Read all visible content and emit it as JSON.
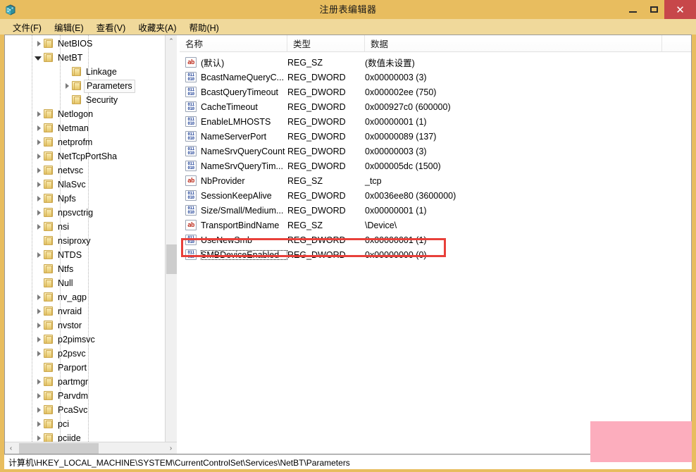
{
  "window": {
    "title": "注册表编辑器",
    "icon": "regedit-icon",
    "minimize_label": "–",
    "maximize_label": "□",
    "close_label": "✕"
  },
  "menubar": {
    "items": [
      {
        "label": "文件(F)",
        "name": "menu-file"
      },
      {
        "label": "编辑(E)",
        "name": "menu-edit"
      },
      {
        "label": "查看(V)",
        "name": "menu-view"
      },
      {
        "label": "收藏夹(A)",
        "name": "menu-favorites"
      },
      {
        "label": "帮助(H)",
        "name": "menu-help"
      }
    ]
  },
  "tree": {
    "nodes": [
      {
        "label": "NetBIOS",
        "indent": 2,
        "expander": "right",
        "selected": false
      },
      {
        "label": "NetBT",
        "indent": 2,
        "expander": "down",
        "selected": false
      },
      {
        "label": "Linkage",
        "indent": 3,
        "expander": "none",
        "selected": false
      },
      {
        "label": "Parameters",
        "indent": 3,
        "expander": "right",
        "selected": true
      },
      {
        "label": "Security",
        "indent": 3,
        "expander": "none",
        "selected": false
      },
      {
        "label": "Netlogon",
        "indent": 2,
        "expander": "right",
        "selected": false
      },
      {
        "label": "Netman",
        "indent": 2,
        "expander": "right",
        "selected": false
      },
      {
        "label": "netprofm",
        "indent": 2,
        "expander": "right",
        "selected": false
      },
      {
        "label": "NetTcpPortSha",
        "indent": 2,
        "expander": "right",
        "selected": false
      },
      {
        "label": "netvsc",
        "indent": 2,
        "expander": "right",
        "selected": false
      },
      {
        "label": "NlaSvc",
        "indent": 2,
        "expander": "right",
        "selected": false
      },
      {
        "label": "Npfs",
        "indent": 2,
        "expander": "right",
        "selected": false
      },
      {
        "label": "npsvctrig",
        "indent": 2,
        "expander": "right",
        "selected": false
      },
      {
        "label": "nsi",
        "indent": 2,
        "expander": "right",
        "selected": false
      },
      {
        "label": "nsiproxy",
        "indent": 2,
        "expander": "none",
        "selected": false
      },
      {
        "label": "NTDS",
        "indent": 2,
        "expander": "right",
        "selected": false
      },
      {
        "label": "Ntfs",
        "indent": 2,
        "expander": "none",
        "selected": false
      },
      {
        "label": "Null",
        "indent": 2,
        "expander": "none",
        "selected": false
      },
      {
        "label": "nv_agp",
        "indent": 2,
        "expander": "right",
        "selected": false
      },
      {
        "label": "nvraid",
        "indent": 2,
        "expander": "right",
        "selected": false
      },
      {
        "label": "nvstor",
        "indent": 2,
        "expander": "right",
        "selected": false
      },
      {
        "label": "p2pimsvc",
        "indent": 2,
        "expander": "right",
        "selected": false
      },
      {
        "label": "p2psvc",
        "indent": 2,
        "expander": "right",
        "selected": false
      },
      {
        "label": "Parport",
        "indent": 2,
        "expander": "none",
        "selected": false
      },
      {
        "label": "partmgr",
        "indent": 2,
        "expander": "right",
        "selected": false
      },
      {
        "label": "Parvdm",
        "indent": 2,
        "expander": "right",
        "selected": false
      },
      {
        "label": "PcaSvc",
        "indent": 2,
        "expander": "right",
        "selected": false
      },
      {
        "label": "pci",
        "indent": 2,
        "expander": "right",
        "selected": false
      },
      {
        "label": "pciide",
        "indent": 2,
        "expander": "right",
        "selected": false
      }
    ],
    "scroll_up_glyph": "⌃",
    "scroll_down_glyph": "⌄",
    "scroll_left_glyph": "‹",
    "scroll_right_glyph": "›"
  },
  "list": {
    "columns": [
      {
        "label": "名称",
        "name": "column-header-name"
      },
      {
        "label": "类型",
        "name": "column-header-type"
      },
      {
        "label": "数据",
        "name": "column-header-data"
      }
    ],
    "rows": [
      {
        "name": "(默认)",
        "type": "REG_SZ",
        "data": "(数值未设置)",
        "icon": "string-value-icon",
        "focused": false
      },
      {
        "name": "BcastNameQueryC...",
        "type": "REG_DWORD",
        "data": "0x00000003 (3)",
        "icon": "dword-value-icon",
        "focused": false
      },
      {
        "name": "BcastQueryTimeout",
        "type": "REG_DWORD",
        "data": "0x000002ee (750)",
        "icon": "dword-value-icon",
        "focused": false
      },
      {
        "name": "CacheTimeout",
        "type": "REG_DWORD",
        "data": "0x000927c0 (600000)",
        "icon": "dword-value-icon",
        "focused": false
      },
      {
        "name": "EnableLMHOSTS",
        "type": "REG_DWORD",
        "data": "0x00000001 (1)",
        "icon": "dword-value-icon",
        "focused": false
      },
      {
        "name": "NameServerPort",
        "type": "REG_DWORD",
        "data": "0x00000089 (137)",
        "icon": "dword-value-icon",
        "focused": false
      },
      {
        "name": "NameSrvQueryCount",
        "type": "REG_DWORD",
        "data": "0x00000003 (3)",
        "icon": "dword-value-icon",
        "focused": false
      },
      {
        "name": "NameSrvQueryTim...",
        "type": "REG_DWORD",
        "data": "0x000005dc (1500)",
        "icon": "dword-value-icon",
        "focused": false
      },
      {
        "name": "NbProvider",
        "type": "REG_SZ",
        "data": "_tcp",
        "icon": "string-value-icon",
        "focused": false
      },
      {
        "name": "SessionKeepAlive",
        "type": "REG_DWORD",
        "data": "0x0036ee80 (3600000)",
        "icon": "dword-value-icon",
        "focused": false
      },
      {
        "name": "Size/Small/Medium...",
        "type": "REG_DWORD",
        "data": "0x00000001 (1)",
        "icon": "dword-value-icon",
        "focused": false
      },
      {
        "name": "TransportBindName",
        "type": "REG_SZ",
        "data": "\\Device\\",
        "icon": "string-value-icon",
        "focused": false
      },
      {
        "name": "UseNewSmb",
        "type": "REG_DWORD",
        "data": "0x00000001 (1)",
        "icon": "dword-value-icon",
        "focused": false
      },
      {
        "name": "SMBDeviceEnabled",
        "type": "REG_DWORD",
        "data": "0x00000000 (0)",
        "icon": "dword-value-icon",
        "focused": true
      }
    ]
  },
  "annotation": {
    "highlight_color": "#e8403a",
    "redaction_color": "#fcadbd"
  },
  "statusbar": {
    "path": "计算机\\HKEY_LOCAL_MACHINE\\SYSTEM\\CurrentControlSet\\Services\\NetBT\\Parameters"
  }
}
